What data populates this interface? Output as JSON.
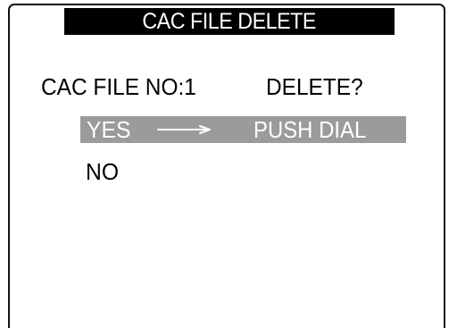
{
  "screen": {
    "title": "CAC FILE DELETE"
  },
  "prompt": {
    "file_label": "CAC FILE NO:1",
    "delete_question": "DELETE?"
  },
  "options": {
    "yes": {
      "label": "YES",
      "arrow_icon": "right-arrow",
      "action_hint": "PUSH DIAL",
      "highlighted": true
    },
    "no": {
      "label": "NO",
      "highlighted": false
    }
  },
  "colors": {
    "title_background": "#000000",
    "title_text": "#ffffff",
    "selection_background": "#9b9b9b",
    "selection_text": "#ffffff",
    "text": "#000000",
    "frame": "#111111"
  }
}
